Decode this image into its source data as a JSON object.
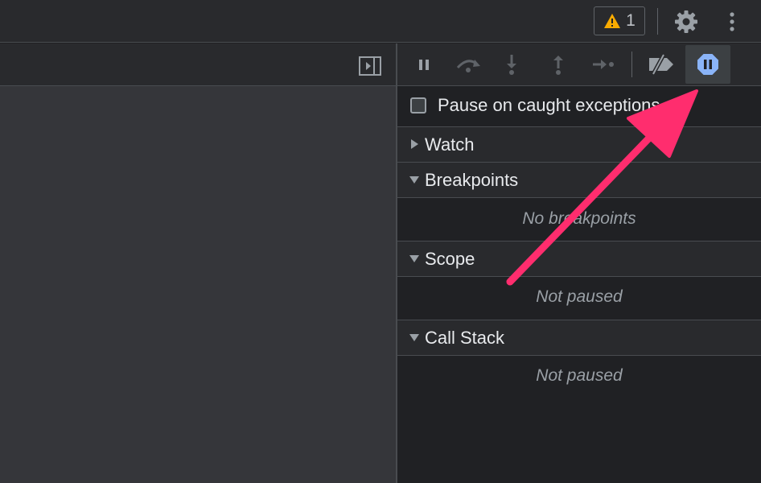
{
  "topbar": {
    "warning_count": "1",
    "icons": [
      "warning-icon",
      "gear-icon",
      "more-vertical-icon"
    ]
  },
  "debug_toolbar": {
    "buttons": [
      {
        "name": "pause-resume-button",
        "icon": "pause-icon"
      },
      {
        "name": "step-over-button",
        "icon": "step-over-icon"
      },
      {
        "name": "step-into-button",
        "icon": "step-into-icon"
      },
      {
        "name": "step-out-button",
        "icon": "step-out-icon"
      },
      {
        "name": "step-button",
        "icon": "step-icon"
      },
      {
        "name": "deactivate-breakpoints-button",
        "icon": "breakpoint-off-icon"
      },
      {
        "name": "pause-on-exceptions-button",
        "icon": "stop-pause-icon",
        "active": true
      }
    ],
    "active_color": "#8ab4f8"
  },
  "exceptions": {
    "label": "Pause on caught exceptions",
    "checked": false
  },
  "sections": {
    "watch": {
      "title": "Watch",
      "expanded": false
    },
    "breakpoints": {
      "title": "Breakpoints",
      "expanded": true,
      "empty_message": "No breakpoints"
    },
    "scope": {
      "title": "Scope",
      "expanded": true,
      "empty_message": "Not paused"
    },
    "call_stack": {
      "title": "Call Stack",
      "expanded": true,
      "empty_message": "Not paused"
    }
  },
  "annotation": {
    "arrow_color": "#ff2d6e"
  },
  "colors": {
    "background": "#202124",
    "toolbar": "#292a2d",
    "border": "#494c50",
    "editor_area": "#35363a",
    "warning": "#f9ab00"
  }
}
